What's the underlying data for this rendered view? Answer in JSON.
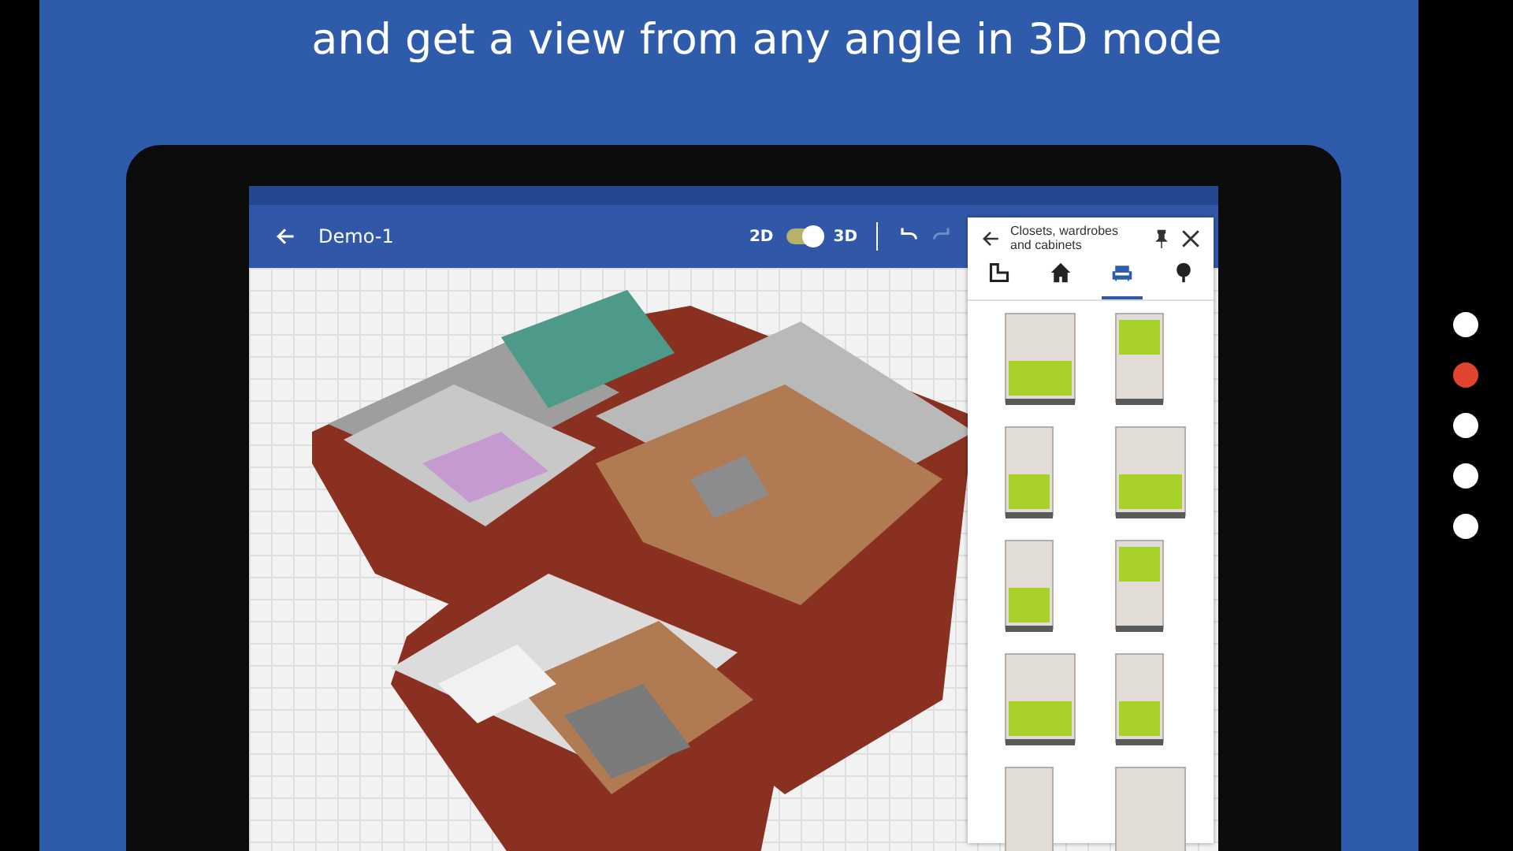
{
  "headline": "and get a view from any angle in 3D mode",
  "pager": [
    {
      "selected": false
    },
    {
      "selected": true
    },
    {
      "selected": false
    },
    {
      "selected": false
    },
    {
      "selected": false
    }
  ],
  "app_bar": {
    "title": "Demo-1",
    "mode_left": "2D",
    "mode_right": "3D",
    "mode_3d": true
  },
  "catalog": {
    "title": "Closets, wardrobes and cabinets",
    "tabs": [
      {
        "kind": "room",
        "selected": false
      },
      {
        "kind": "house",
        "selected": false
      },
      {
        "kind": "sofa",
        "selected": true
      },
      {
        "kind": "tree",
        "selected": false
      }
    ]
  }
}
